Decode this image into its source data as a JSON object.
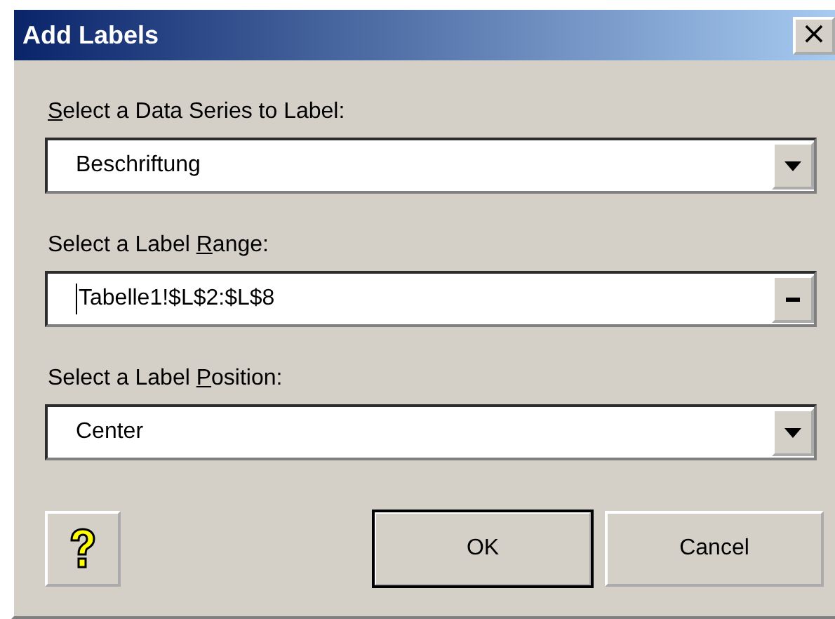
{
  "window": {
    "title": "Add Labels",
    "close": "×"
  },
  "fields": [
    {
      "kind": "dropdown",
      "label": {
        "key": "S",
        "after": "elect a Data Series to Label:"
      },
      "value": "Beschriftung",
      "focused": false
    },
    {
      "kind": "range",
      "label": {
        "before": "Select a Label ",
        "key": "R",
        "after": "ange:"
      },
      "value": "Tabelle1!$L$2:$L$8",
      "focused": true
    },
    {
      "kind": "dropdown",
      "label": {
        "before": "Select a Label ",
        "key": "P",
        "after": "osition:"
      },
      "value": "Center",
      "focused": false
    }
  ],
  "buttons": [
    {
      "label": "OK",
      "default": true
    },
    {
      "label": "Cancel",
      "default": false
    }
  ]
}
